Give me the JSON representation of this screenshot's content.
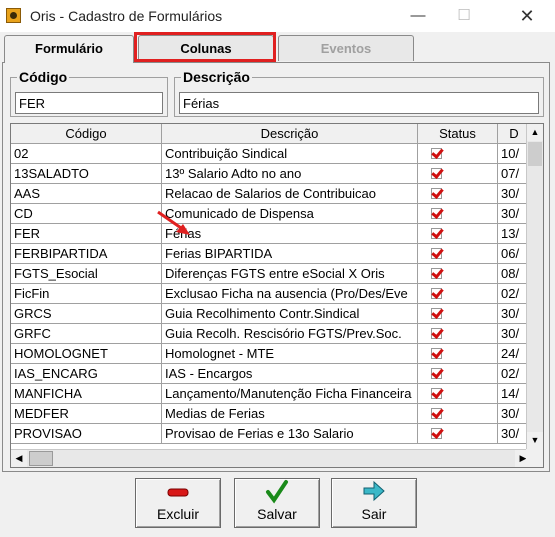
{
  "window": {
    "title": "Oris - Cadastro de Formulários",
    "min_glyph": "—",
    "max_glyph": "☐",
    "close_glyph": "✕"
  },
  "tabs": [
    {
      "label": "Formulário",
      "state": "active"
    },
    {
      "label": "Colunas",
      "state": "normal"
    },
    {
      "label": "Eventos",
      "state": "disabled"
    }
  ],
  "highlight_color": "#e02020",
  "fields": {
    "codigo": {
      "label": "Código",
      "value": "FER"
    },
    "descricao": {
      "label": "Descrição",
      "value": "Férias"
    }
  },
  "grid": {
    "headers": [
      "Código",
      "Descrição",
      "Status",
      "D"
    ],
    "rows": [
      {
        "code": "02",
        "desc": "Contribuição Sindical",
        "status": true,
        "date": "10/"
      },
      {
        "code": "13SALADTO",
        "desc": "13º Salario Adto no ano",
        "status": true,
        "date": "07/"
      },
      {
        "code": "AAS",
        "desc": "Relacao de Salarios de Contribuicao",
        "status": true,
        "date": "30/"
      },
      {
        "code": "CD",
        "desc": "Comunicado de Dispensa",
        "status": true,
        "date": "30/"
      },
      {
        "code": "FER",
        "desc": "Férias",
        "status": true,
        "date": "13/"
      },
      {
        "code": "FERBIPARTIDA",
        "desc": "Ferias BIPARTIDA",
        "status": true,
        "date": "06/"
      },
      {
        "code": "FGTS_Esocial",
        "desc": "Diferenças FGTS entre eSocial X Oris",
        "status": true,
        "date": "08/"
      },
      {
        "code": "FicFin",
        "desc": "Exclusao Ficha na ausencia (Pro/Des/Eve",
        "status": true,
        "date": "02/"
      },
      {
        "code": "GRCS",
        "desc": "Guia Recolhimento Contr.Sindical",
        "status": true,
        "date": "30/"
      },
      {
        "code": "GRFC",
        "desc": "Guia Recolh. Rescisório FGTS/Prev.Soc.",
        "status": true,
        "date": "30/"
      },
      {
        "code": "HOMOLOGNET",
        "desc": "Homolognet - MTE",
        "status": true,
        "date": "24/"
      },
      {
        "code": "IAS_ENCARG",
        "desc": "IAS - Encargos",
        "status": true,
        "date": "02/"
      },
      {
        "code": "MANFICHA",
        "desc": "Lançamento/Manutenção Ficha Financeira",
        "status": true,
        "date": "14/"
      },
      {
        "code": "MEDFER",
        "desc": "Medias de Ferias",
        "status": true,
        "date": "30/"
      },
      {
        "code": "PROVISAO",
        "desc": "Provisao de Ferias e 13o Salario",
        "status": true,
        "date": "30/"
      }
    ]
  },
  "buttons": {
    "excluir": "Excluir",
    "salvar": "Salvar",
    "sair": "Sair"
  },
  "icons": {
    "excluir": "minus-icon",
    "salvar": "checkmark-icon",
    "sair": "exit-arrow-icon",
    "annotation": "red-arrow-icon"
  }
}
